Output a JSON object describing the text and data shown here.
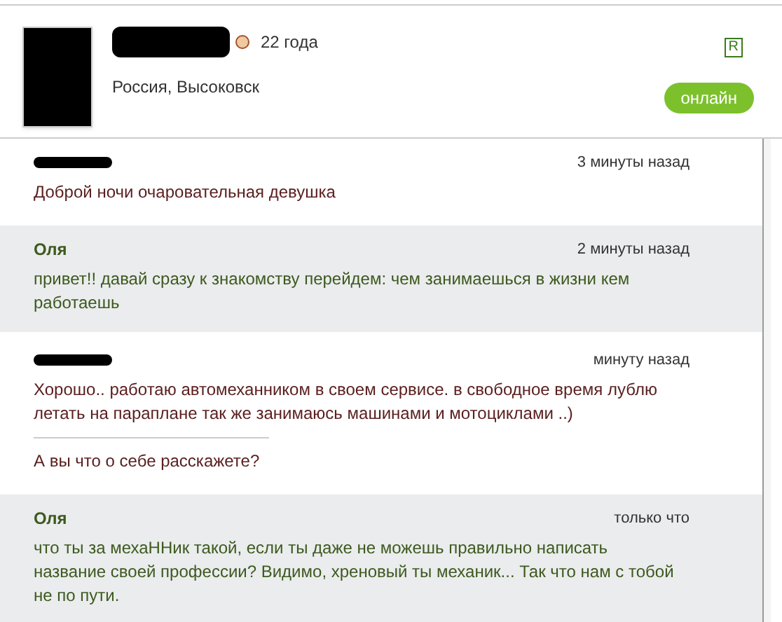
{
  "profile": {
    "age": "22 года",
    "location": "Россия, Высоковск",
    "badge": "R",
    "status": "онлайн",
    "online": true
  },
  "messages": [
    {
      "kind": "him",
      "time": "3 минуты назад",
      "parts": [
        "Доброй ночи очаровательная девушка"
      ]
    },
    {
      "kind": "her",
      "author": "Оля",
      "time": "2 минуты назад",
      "parts": [
        "привет!! давай сразу к знакомству перейдем: чем занимаешься в жизни кем работаешь"
      ]
    },
    {
      "kind": "him",
      "time": "минуту назад",
      "parts": [
        "Хорошо.. работаю автомеханником в своем сервисе. в свободное время лублю летать на параплане так же занимаюсь машинами и мотоциклами ..)",
        "А вы что о себе расскажете?"
      ]
    },
    {
      "kind": "her",
      "author": "Оля",
      "time": "только что",
      "parts": [
        "что ты за мехаННик такой, если ты даже не можешь правильно написать название своей профессии? Видимо, хреновый ты механик... Так что нам с тобой не по пути."
      ]
    }
  ]
}
